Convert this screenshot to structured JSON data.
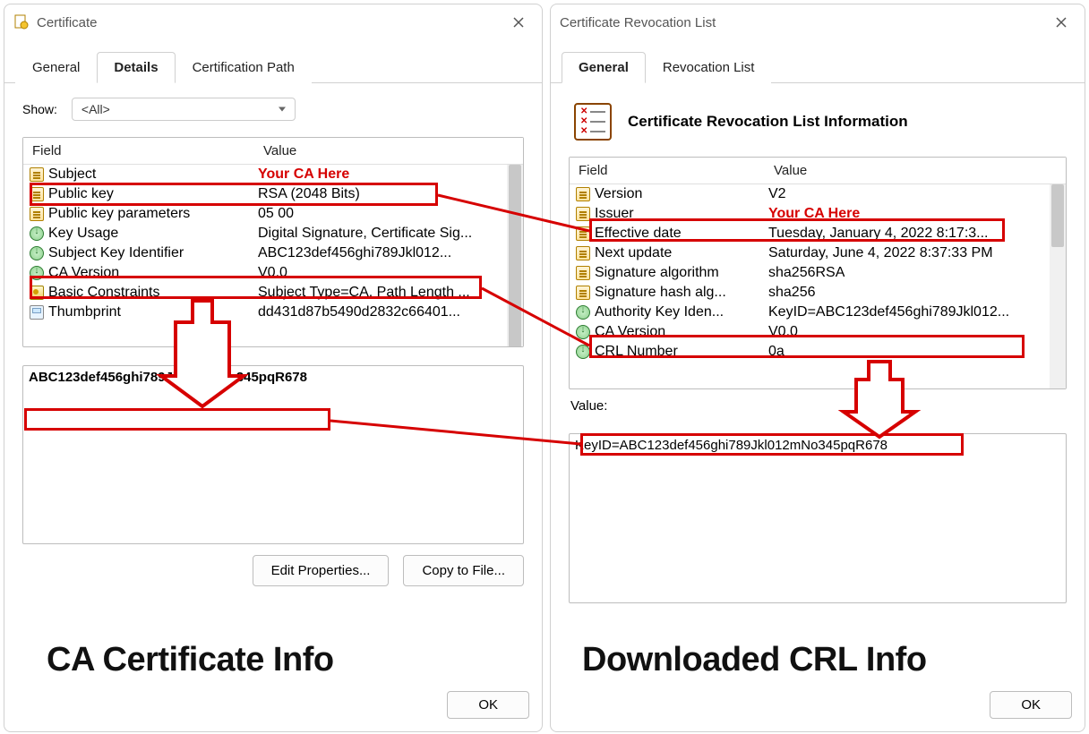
{
  "left_dialog": {
    "title": "Certificate",
    "tabs": [
      "General",
      "Details",
      "Certification Path"
    ],
    "active_tab_index": 1,
    "show_label": "Show:",
    "show_value": "<All>",
    "columns": [
      "Field",
      "Value"
    ],
    "rows": [
      {
        "icon": "doc",
        "field": "Subject",
        "value": "Your CA Here",
        "highlight": true
      },
      {
        "icon": "doc",
        "field": "Public key",
        "value": "RSA (2048 Bits)"
      },
      {
        "icon": "doc",
        "field": "Public key parameters",
        "value": "05 00"
      },
      {
        "icon": "ext",
        "field": "Key Usage",
        "value": "Digital Signature, Certificate Sig..."
      },
      {
        "icon": "ext",
        "field": "Subject Key Identifier",
        "value": "ABC123def456ghi789Jkl012...",
        "highlight": true
      },
      {
        "icon": "ext",
        "field": "CA Version",
        "value": "V0.0"
      },
      {
        "icon": "seal",
        "field": "Basic Constraints",
        "value": "Subject Type=CA, Path Length ..."
      },
      {
        "icon": "print",
        "field": "Thumbprint",
        "value": "dd431d87b5490d2832c66401..."
      }
    ],
    "detail_value": "ABC123def456ghi789Jkl012mNo345pqR678",
    "edit_button": "Edit Properties...",
    "copy_button": "Copy to File...",
    "ok_button": "OK",
    "caption": "CA Certificate Info"
  },
  "right_dialog": {
    "title": "Certificate Revocation List",
    "tabs": [
      "General",
      "Revocation List"
    ],
    "active_tab_index": 0,
    "info_title": "Certificate Revocation List Information",
    "columns": [
      "Field",
      "Value"
    ],
    "rows": [
      {
        "icon": "doc",
        "field": "Version",
        "value": "V2"
      },
      {
        "icon": "doc",
        "field": "Issuer",
        "value": "Your CA Here",
        "highlight": true
      },
      {
        "icon": "doc",
        "field": "Effective date",
        "value": "Tuesday, January 4, 2022 8:17:3..."
      },
      {
        "icon": "doc",
        "field": "Next update",
        "value": "Saturday, June 4, 2022 8:37:33 PM"
      },
      {
        "icon": "doc",
        "field": "Signature algorithm",
        "value": "sha256RSA"
      },
      {
        "icon": "doc",
        "field": "Signature hash alg...",
        "value": "sha256"
      },
      {
        "icon": "ext",
        "field": "Authority Key Iden...",
        "value": "KeyID=ABC123def456ghi789Jkl012...",
        "highlight": true
      },
      {
        "icon": "ext",
        "field": "CA Version",
        "value": "V0.0"
      },
      {
        "icon": "ext",
        "field": "CRL Number",
        "value": "0a"
      }
    ],
    "value_label": "Value:",
    "detail_value": "KeyID=ABC123def456ghi789Jkl012mNo345pqR678",
    "ok_button": "OK",
    "caption": "Downloaded CRL Info"
  },
  "colors": {
    "annotation": "#d60000"
  }
}
